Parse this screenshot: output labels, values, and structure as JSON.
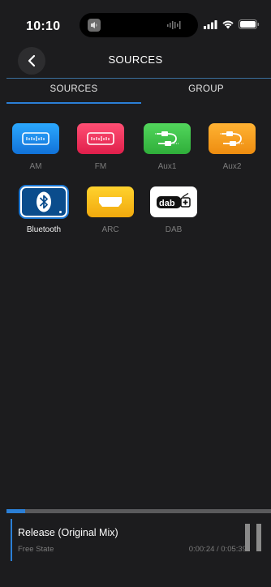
{
  "status": {
    "time": "10:10"
  },
  "nav": {
    "title": "SOURCES"
  },
  "tabs": [
    {
      "label": "SOURCES",
      "selected": true
    },
    {
      "label": "GROUP",
      "selected": false
    }
  ],
  "sources": [
    {
      "label": "AM",
      "icon": "am-radio-icon",
      "color": "#1e90f0",
      "active": false
    },
    {
      "label": "FM",
      "icon": "fm-radio-icon",
      "color": "#f0305a",
      "active": false
    },
    {
      "label": "Aux1",
      "icon": "aux-cable-icon",
      "color": "#3fc34a",
      "active": false
    },
    {
      "label": "Aux2",
      "icon": "aux-cable-icon",
      "color": "#f5a01e",
      "active": false
    },
    {
      "label": "Bluetooth",
      "icon": "bluetooth-icon",
      "color": "#0a4c8c",
      "active": true
    },
    {
      "label": "ARC",
      "icon": "hdmi-icon",
      "color": "#f7c21a",
      "active": false
    },
    {
      "label": "DAB",
      "icon": "dab-plus-icon",
      "color": "#ffffff",
      "active": false
    }
  ],
  "player": {
    "title": "Release (Original Mix)",
    "artist": "Free State",
    "time": "0:00:24 / 0:05:39",
    "progress": 0.07,
    "accent_color": "#2b7fd6"
  }
}
